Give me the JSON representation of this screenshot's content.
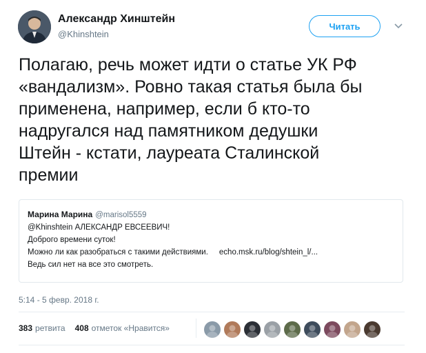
{
  "author": {
    "name": "Александр Хинштейн",
    "handle": "@Khinshtein"
  },
  "follow_button": {
    "label": "Читать"
  },
  "tweet": {
    "lines": [
      "Полагаю, речь может идти о статье УК РФ",
      "«вандализм». Ровно такая статья была бы",
      "применена, например, если б кто-то",
      "надругался над памятником дедушки",
      "Штейн - кстати, лауреата Сталинской",
      "премии"
    ]
  },
  "quoted_tweet": {
    "name": "Марина Марина",
    "handle": "@marisol5559",
    "lines": [
      "@Khinshtein АЛЕКСАНДР ЕВСЕЕВИЧ!",
      "Доброго времени суток!",
      "Можно ли как разобраться с такими действиями."
    ],
    "link": "echo.msk.ru/blog/shtein_l/...",
    "last_line": "Ведь сил нет на все это смотреть."
  },
  "timestamp": "5:14 - 5 февр. 2018 г.",
  "stats": {
    "retweets_count": "383",
    "retweets_label": "ретвита",
    "likes_count": "408",
    "likes_label": "отметок «Нравится»"
  },
  "colors": {
    "accent": "#1da1f2",
    "secondary_text": "#657786",
    "border": "#e1e8ed"
  },
  "likers": [
    {
      "icon": "avatar-1",
      "color": "#8a9aa8"
    },
    {
      "icon": "avatar-2",
      "color": "#b07a5a"
    },
    {
      "icon": "avatar-3",
      "color": "#2b2f36"
    },
    {
      "icon": "avatar-4",
      "color": "#9aa0a6"
    },
    {
      "icon": "avatar-5",
      "color": "#5d6b4a"
    },
    {
      "icon": "avatar-6",
      "color": "#3e4c5c"
    },
    {
      "icon": "avatar-7",
      "color": "#7c4a5e"
    },
    {
      "icon": "avatar-8",
      "color": "#c2a58c"
    },
    {
      "icon": "avatar-9",
      "color": "#4a3a30"
    }
  ]
}
